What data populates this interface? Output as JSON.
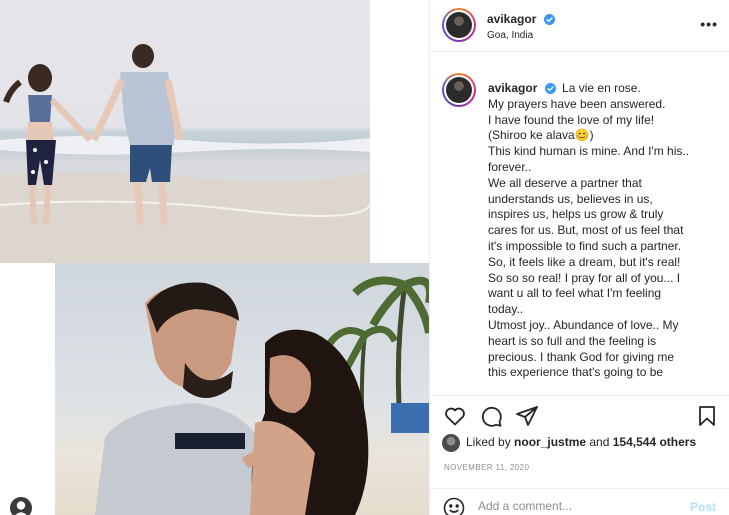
{
  "post": {
    "username": "avikagor",
    "location": "Goa, India",
    "more_label": "•••",
    "caption_user": "avikagor",
    "caption_lines": [
      "La vie en rose.",
      "My prayers have been answered.",
      "I have found the love of my life!",
      "(Shiroo ke alava😊)",
      "This kind human is mine. And I'm his..",
      "forever..",
      "We all deserve a partner that",
      "understands us, believes in us,",
      "inspires us, helps us grow & truly",
      "cares for us. But, most of us feel that",
      "it's impossible to find such a partner.",
      "So, it feels like a dream, but it's real!",
      "So so so real! I pray for all of you... I",
      "want u all to feel what I'm feeling",
      "today..",
      "Utmost joy.. Abundance of love.. My",
      "heart is so full and the feeling is",
      "precious. I thank God for giving me",
      "this experience that's going to be"
    ],
    "likes": {
      "prefix": "Liked by ",
      "user": "noor_justme",
      "middle": " and ",
      "count": "154,544 others"
    },
    "date": "NOVEMBER 11, 2020",
    "comment_placeholder": "Add a comment...",
    "post_button": "Post"
  },
  "icons": {
    "verified": "verified-badge-icon",
    "like": "heart-icon",
    "comment": "comment-bubble-icon",
    "share": "paper-plane-icon",
    "save": "bookmark-icon",
    "emoji": "smiley-icon",
    "more": "ellipsis-icon"
  },
  "colors": {
    "verified_blue": "#3897f0",
    "post_button_disabled": "#b2dffc",
    "muted_text": "#8e8e8e"
  }
}
